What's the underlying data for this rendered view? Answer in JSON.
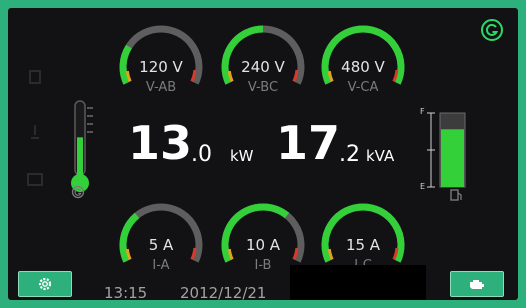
{
  "colors": {
    "accent": "#2db07b",
    "gauge_green": "#33d03a",
    "gauge_red": "#d63a2a",
    "gauge_orange": "#e2a21e",
    "screen_bg": "#121215"
  },
  "brand_icon": "g-logo-icon",
  "voltage_gauges": [
    {
      "value": "120 V",
      "label": "V-AB",
      "fill": 0.25
    },
    {
      "value": "240 V",
      "label": "V-BC",
      "fill": 0.5
    },
    {
      "value": "480 V",
      "label": "V-CA",
      "fill": 1.0
    }
  ],
  "current_gauges": [
    {
      "value": "5 A",
      "label": "I-A",
      "fill": 0.33
    },
    {
      "value": "10 A",
      "label": "I-B",
      "fill": 0.67
    },
    {
      "value": "15 A",
      "label": "I-C",
      "fill": 1.0
    }
  ],
  "power": {
    "kw_int": "13",
    "kw_dec": ".0",
    "kw_unit": "kW",
    "kva_int": "17",
    "kva_dec": ".2",
    "kva_unit": "kVA"
  },
  "temperature": {
    "icon": "thermometer-icon",
    "level": 0.55,
    "mode_icon": "g-icon"
  },
  "fuel": {
    "icon": "fuel-pump-icon",
    "level": 0.78,
    "full_label": "F",
    "empty_label": "E"
  },
  "footer": {
    "time": "13:15",
    "date": "2012/12/21",
    "settings_icon": "gear-icon",
    "engine_icon": "engine-icon"
  }
}
